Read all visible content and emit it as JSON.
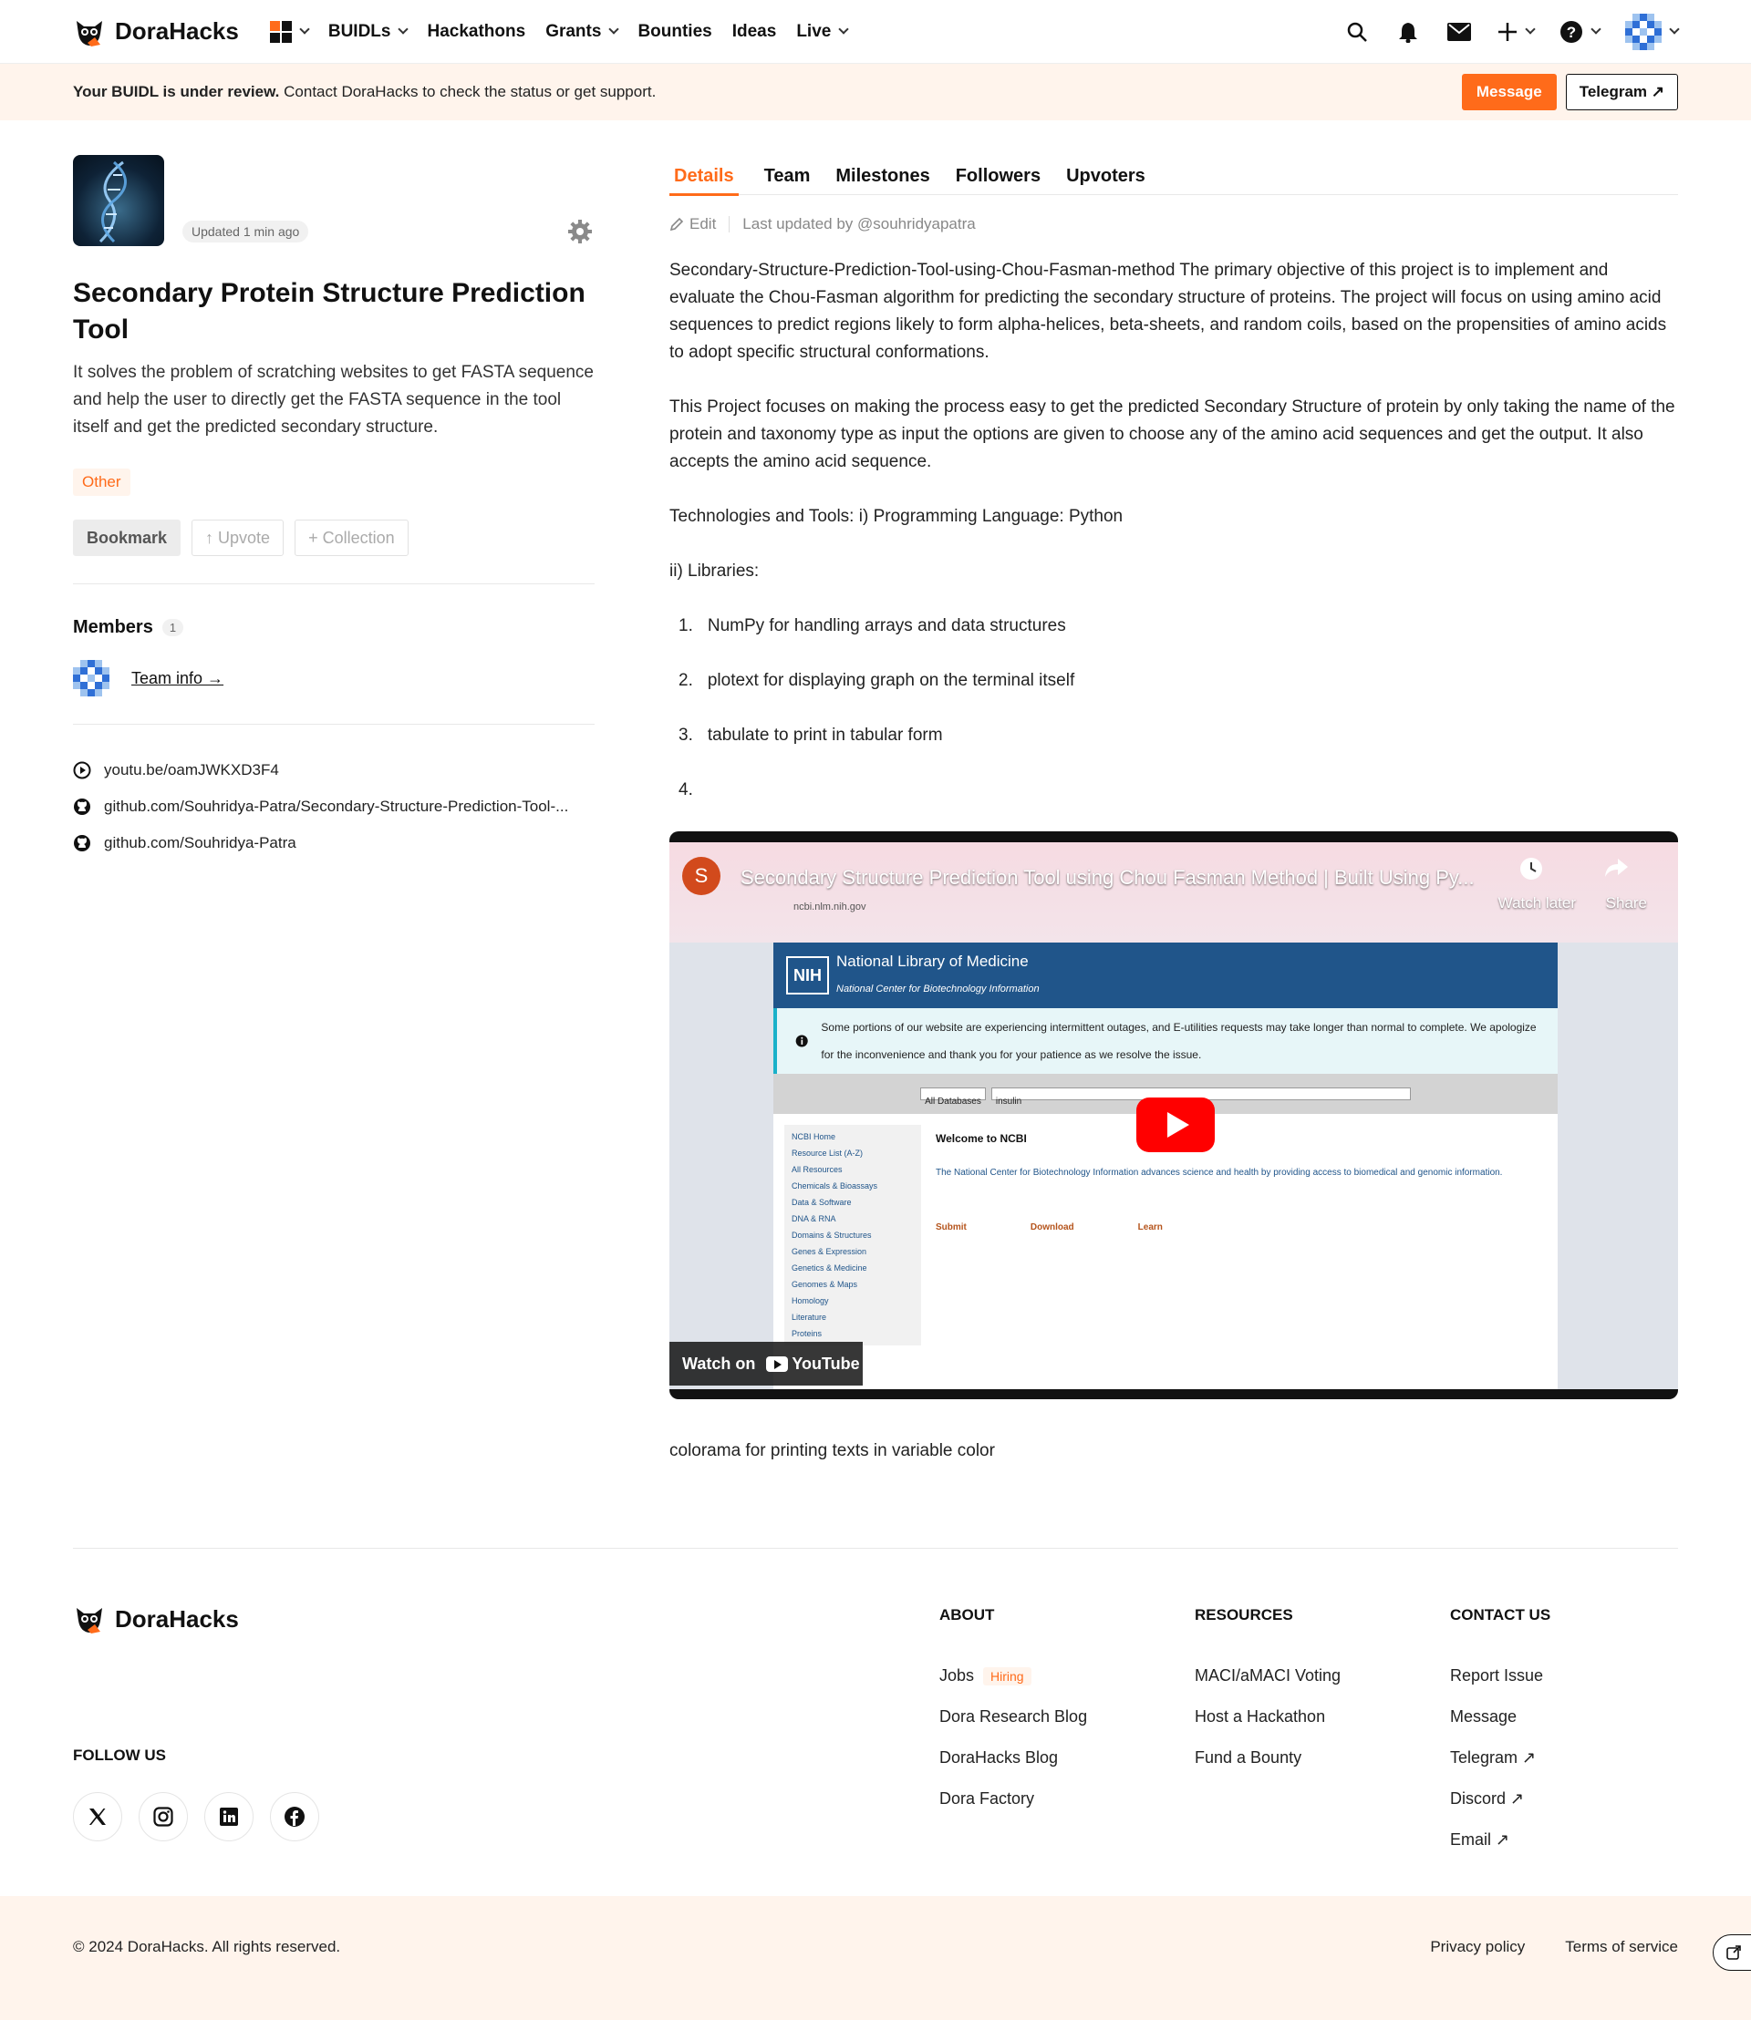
{
  "nav": {
    "brand": "DoraHacks",
    "items": [
      {
        "label": "BUIDLs",
        "has_menu": true
      },
      {
        "label": "Hackathons",
        "has_menu": false
      },
      {
        "label": "Grants",
        "has_menu": true
      },
      {
        "label": "Bounties",
        "has_menu": false
      },
      {
        "label": "Ideas",
        "has_menu": false
      },
      {
        "label": "Live",
        "has_menu": true
      }
    ],
    "icons": [
      "apps-grid-icon",
      "search-icon",
      "bell-icon",
      "mail-icon",
      "plus-icon",
      "help-icon",
      "avatar"
    ]
  },
  "banner": {
    "bold": "Your BUIDL is under review.",
    "text": " Contact DoraHacks to check the status or get support.",
    "message_label": "Message",
    "telegram_label": "Telegram ↗"
  },
  "project": {
    "updated": "Updated 1 min ago",
    "title": "Secondary Protein Structure Prediction Tool",
    "description": "It solves the problem of scratching websites to get FASTA sequence and help the user to directly get the FASTA sequence in the tool itself and get the predicted secondary structure.",
    "tag": "Other",
    "bookmark_label": "Bookmark",
    "upvote_label": "↑ Upvote",
    "collection_label": "+ Collection",
    "members_title": "Members",
    "members_count": "1",
    "team_info_label": "Team info →",
    "links": [
      {
        "icon": "play-circle-icon",
        "text": "youtu.be/oamJWKXD3F4"
      },
      {
        "icon": "github-icon",
        "text": "github.com/Souhridya-Patra/Secondary-Structure-Prediction-Tool-..."
      },
      {
        "icon": "github-icon",
        "text": "github.com/Souhridya-Patra"
      }
    ]
  },
  "tabs": [
    {
      "label": "Details",
      "active": true
    },
    {
      "label": "Team",
      "active": false
    },
    {
      "label": "Milestones",
      "active": false
    },
    {
      "label": "Followers",
      "active": false
    },
    {
      "label": "Upvoters",
      "active": false
    }
  ],
  "details": {
    "edit_label": "Edit",
    "last_updated": "Last updated by @souhridyapatra",
    "paragraphs": [
      "Secondary-Structure-Prediction-Tool-using-Chou-Fasman-method The primary objective of this project is to implement and evaluate the Chou-Fasman algorithm for predicting the secondary structure of proteins. The project will focus on using amino acid sequences to predict regions likely to form alpha-helices, beta-sheets, and random coils, based on the propensities of amino acids to adopt specific structural conformations.",
      "This Project focuses on making the process easy to get the predicted Secondary Structure of protein by only taking the name of the protein and taxonomy type as input the options are given to choose any of the amino acid sequences and get the output. It also accepts the amino acid sequence.",
      "Technologies and Tools: i) Programming Language: Python",
      "ii) Libraries:"
    ],
    "list": [
      {
        "num": "1.",
        "text": "NumPy for handling arrays and data structures"
      },
      {
        "num": "2.",
        "text": "plotext for displaying graph on the terminal itself"
      },
      {
        "num": "3.",
        "text": "tabulate to print in tabular form"
      },
      {
        "num": "4.",
        "text": ""
      }
    ],
    "after_video": "colorama for printing texts in variable color"
  },
  "video": {
    "channel_initial": "S",
    "title": "Secondary Structure Prediction Tool using Chou Fasman Method | Built Using Py...",
    "watch_later": "Watch later",
    "share": "Share",
    "watch_on": "Watch on",
    "youtube": "YouTube",
    "page_url": "ncbi.nlm.nih.gov",
    "nih_logo": "NIH",
    "nih_name": "National Library of Medicine",
    "nih_sub": "National Center for Biotechnology Information",
    "notice": "Some portions of our website are experiencing intermittent outages, and E-utilities requests may take longer than normal to complete. We apologize for the inconvenience and thank you for your patience as we resolve the issue.",
    "search_db": "All Databases",
    "search_term": "insulin",
    "welcome": "Welcome to NCBI",
    "welcome_text": "The National Center for Biotechnology Information advances science and health by providing access to biomedical and genomic information.",
    "side_items": [
      "NCBI Home",
      "Resource List (A-Z)",
      "All Resources",
      "Chemicals & Bioassays",
      "Data & Software",
      "DNA & RNA",
      "Domains & Structures",
      "Genes & Expression",
      "Genetics & Medicine",
      "Genomes & Maps",
      "Homology",
      "Literature",
      "Proteins"
    ],
    "sections": [
      "Submit",
      "Download",
      "Learn"
    ]
  },
  "footer": {
    "brand": "DoraHacks",
    "follow_us": "FOLLOW US",
    "socials": [
      "x-icon",
      "instagram-icon",
      "linkedin-icon",
      "facebook-icon"
    ],
    "about_title": "ABOUT",
    "about_links": [
      "Jobs",
      "Dora Research Blog",
      "DoraHacks Blog",
      "Dora Factory"
    ],
    "hiring": "Hiring",
    "resources_title": "RESOURCES",
    "resources_links": [
      "MACI/aMACI Voting",
      "Host a Hackathon",
      "Fund a Bounty"
    ],
    "contact_title": "CONTACT US",
    "contact_links": [
      "Report Issue",
      "Message",
      "Telegram ↗",
      "Discord ↗",
      "Email ↗"
    ],
    "copyright": "© 2024 DoraHacks. All rights reserved.",
    "privacy": "Privacy policy",
    "terms": "Terms of service"
  },
  "colors": {
    "accent": "#ff6b1a",
    "banner_bg": "#fff4ec",
    "nih_blue": "#20558a",
    "yt_red": "#ff0000"
  }
}
